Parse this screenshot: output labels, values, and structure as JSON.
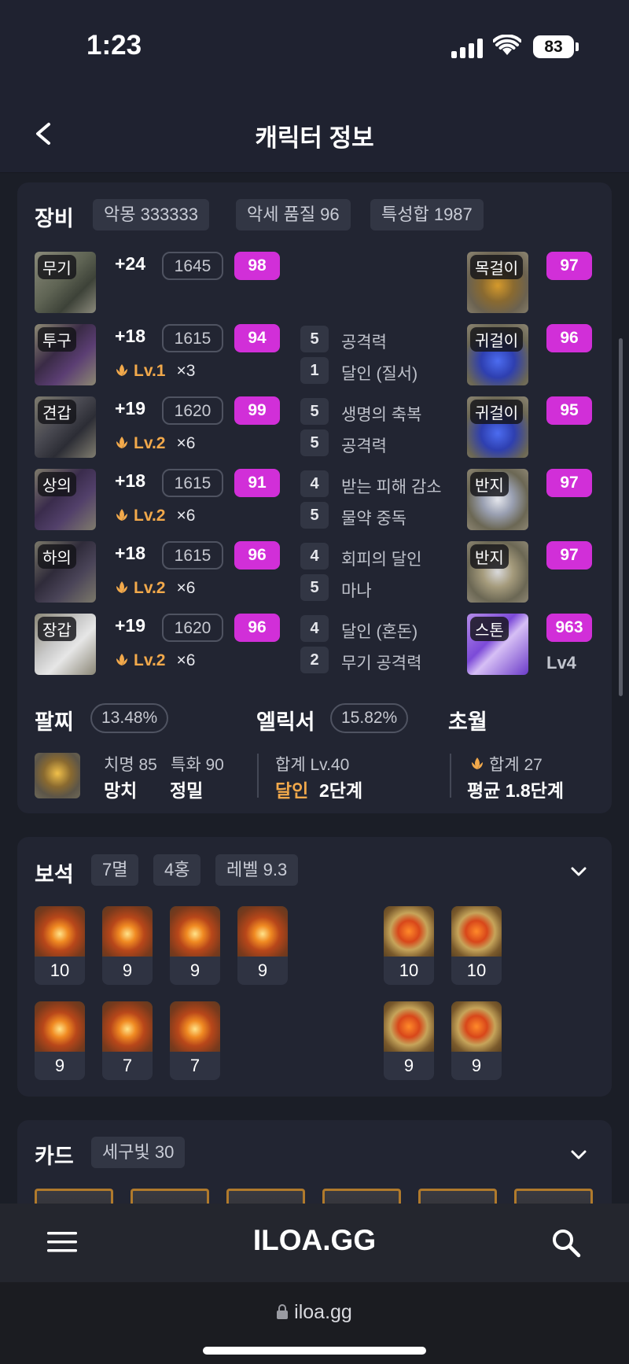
{
  "status": {
    "time": "1:23",
    "battery": "83"
  },
  "header": {
    "title": "캐릭터 정보"
  },
  "equipment": {
    "title": "장비",
    "chips": [
      "악몽 333333",
      "악세 품질 96",
      "특성합 1987"
    ],
    "gear": [
      {
        "slot": "무기",
        "upgrade": "+24",
        "item_level": "1645",
        "quality": "98"
      },
      {
        "slot": "투구",
        "upgrade": "+18",
        "item_level": "1615",
        "quality": "94",
        "transcend_level": "Lv.1",
        "transcend_mult": "×3"
      },
      {
        "slot": "견갑",
        "upgrade": "+19",
        "item_level": "1620",
        "quality": "99",
        "transcend_level": "Lv.2",
        "transcend_mult": "×6"
      },
      {
        "slot": "상의",
        "upgrade": "+18",
        "item_level": "1615",
        "quality": "91",
        "transcend_level": "Lv.2",
        "transcend_mult": "×6"
      },
      {
        "slot": "하의",
        "upgrade": "+18",
        "item_level": "1615",
        "quality": "96",
        "transcend_level": "Lv.2",
        "transcend_mult": "×6"
      },
      {
        "slot": "장갑",
        "upgrade": "+19",
        "item_level": "1620",
        "quality": "96",
        "transcend_level": "Lv.2",
        "transcend_mult": "×6"
      }
    ],
    "engravings": [
      {
        "level": "5",
        "name": "공격력"
      },
      {
        "level": "1",
        "name": "달인 (질서)"
      },
      {
        "level": "5",
        "name": "생명의 축복"
      },
      {
        "level": "5",
        "name": "공격력"
      },
      {
        "level": "4",
        "name": "받는 피해 감소"
      },
      {
        "level": "5",
        "name": "물약 중독"
      },
      {
        "level": "4",
        "name": "회피의 달인"
      },
      {
        "level": "5",
        "name": "마나"
      },
      {
        "level": "4",
        "name": "달인 (혼돈)"
      },
      {
        "level": "2",
        "name": "무기 공격력"
      }
    ],
    "accessories": [
      {
        "slot": "목걸이",
        "quality": "97"
      },
      {
        "slot": "귀걸이",
        "quality": "96"
      },
      {
        "slot": "귀걸이",
        "quality": "95"
      },
      {
        "slot": "반지",
        "quality": "97"
      },
      {
        "slot": "반지",
        "quality": "97"
      },
      {
        "slot": "스톤",
        "quality": "963",
        "extra": "Lv4"
      }
    ],
    "bracelet": {
      "title": "팔찌",
      "pct": "13.48%",
      "stat1": "치명 85",
      "stat2": "특화 90",
      "line1": "망치",
      "line2": "정밀"
    },
    "elixir": {
      "title": "엘릭서",
      "pct": "15.82%",
      "total": "합계 Lv.40",
      "effect": "달인",
      "stage": "2단계"
    },
    "transcend": {
      "title": "초월",
      "total": "합계 27",
      "avg": "평균 1.8단계"
    }
  },
  "gems": {
    "title": "보석",
    "chips": [
      "7멸",
      "4홍",
      "레벨 9.3"
    ],
    "row1_left": [
      "10",
      "9",
      "9",
      "9"
    ],
    "row2_left": [
      "9",
      "7",
      "7"
    ],
    "row1_right": [
      "10",
      "10"
    ],
    "row2_right": [
      "9",
      "9"
    ]
  },
  "cards": {
    "title": "카드",
    "chip": "세구빛 30"
  },
  "bottom": {
    "logo": "ILOA.GG",
    "url": "iloa.gg"
  },
  "colors": {
    "quality": "#d12fd8",
    "accent": "#f2a94b",
    "background": "#1b1e27",
    "card": "#222532"
  }
}
